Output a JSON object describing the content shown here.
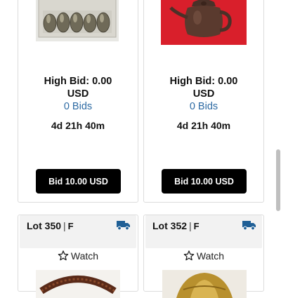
{
  "lots": [
    {
      "image": "silver-salt-pepper-set-image",
      "high_bid": "High Bid: 0.00",
      "currency": "USD",
      "bids": "0 Bids",
      "time_left": "4d 21h 40m",
      "bid_button": "Bid 10.00 USD"
    },
    {
      "image": "clay-teapot-image",
      "high_bid": "High Bid: 0.00",
      "currency": "USD",
      "bids": "0 Bids",
      "time_left": "4d 21h 40m",
      "bid_button": "Bid 10.00 USD"
    },
    {
      "lot_label": "Lot 350",
      "separator": "|",
      "flag": "F",
      "shipping_icon": "truck-icon",
      "watch_label": "Watch",
      "watch_icon": "star-outline-icon",
      "image": "woven-basket-image"
    },
    {
      "lot_label": "Lot 352",
      "separator": "|",
      "flag": "F",
      "shipping_icon": "truck-icon",
      "watch_label": "Watch",
      "watch_icon": "star-outline-icon",
      "image": "brass-ornament-image"
    }
  ],
  "colors": {
    "link": "#2d6aa3",
    "button_bg": "#000000",
    "truck_icon": "#1f5f96",
    "header_bg": "#f2f2f2"
  }
}
